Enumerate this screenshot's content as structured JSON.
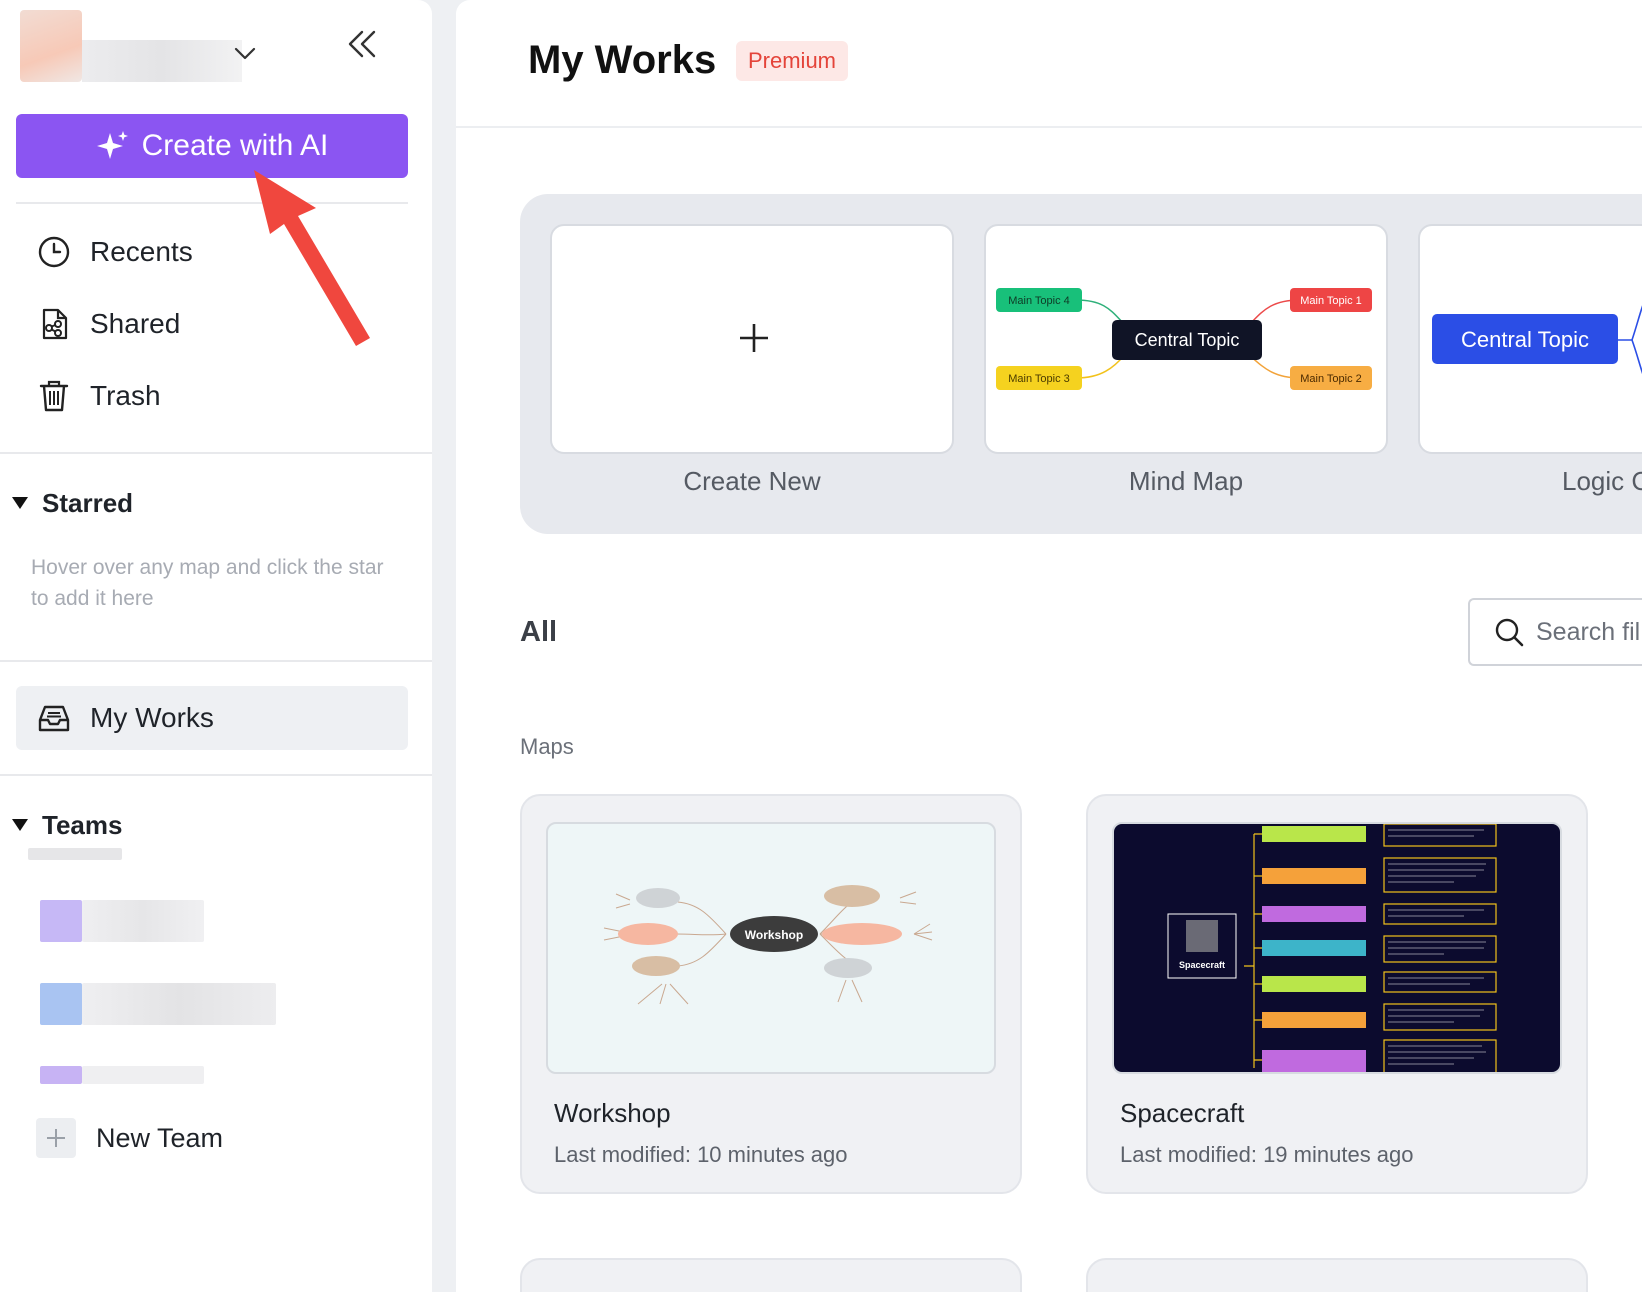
{
  "sidebar": {
    "create_ai_label": "Create with AI",
    "nav": {
      "recents": "Recents",
      "shared": "Shared",
      "trash": "Trash"
    },
    "starred": {
      "title": "Starred",
      "hint": "Hover over any map and click the star to add it here"
    },
    "my_works": "My Works",
    "teams": {
      "title": "Teams",
      "new_team": "New Team"
    }
  },
  "header": {
    "title": "My Works",
    "badge": "Premium"
  },
  "templates": {
    "create_new": "Create New",
    "mind_map": {
      "label": "Mind Map",
      "central": "Central Topic",
      "topics": [
        "Main Topic 4",
        "Main Topic 1",
        "Main Topic 3",
        "Main Topic 2"
      ]
    },
    "logic_chart": {
      "label": "Logic C",
      "central": "Central Topic"
    }
  },
  "files": {
    "section_title": "All",
    "search_placeholder": "Search fil",
    "group_label": "Maps",
    "cards": [
      {
        "title": "Workshop",
        "meta": "Last modified: 10 minutes ago",
        "central": "Workshop"
      },
      {
        "title": "Spacecraft",
        "meta": "Last modified: 19 minutes ago",
        "central": "Spacecraft"
      }
    ]
  },
  "colors": {
    "accent_purple": "#8b55f2",
    "premium_text": "#e4443a",
    "logic_blue": "#2b4ee6",
    "annotation_red": "#f0473e"
  }
}
